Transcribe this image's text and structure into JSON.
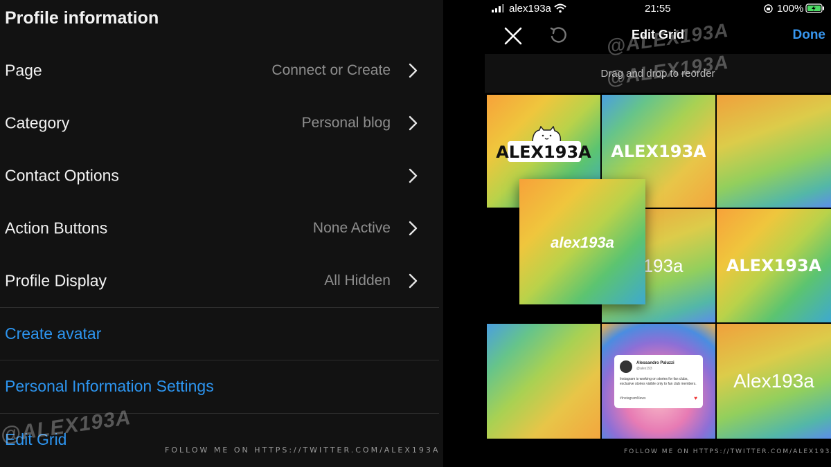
{
  "left": {
    "title": "Profile information",
    "rows": [
      {
        "label": "Page",
        "value": "Connect or Create"
      },
      {
        "label": "Category",
        "value": "Personal blog"
      },
      {
        "label": "Contact Options",
        "value": ""
      },
      {
        "label": "Action Buttons",
        "value": "None Active"
      },
      {
        "label": "Profile Display",
        "value": "All Hidden"
      }
    ],
    "links": [
      "Create avatar",
      "Personal Information Settings",
      "Edit Grid"
    ],
    "watermark": "@ALEX193A",
    "footer": "FOLLOW ME ON HTTPS://TWITTER.COM/ALEX193A"
  },
  "right": {
    "status": {
      "carrier": "alex193a",
      "time": "21:55",
      "battery": "100%"
    },
    "nav": {
      "title": "Edit Grid",
      "done": "Done"
    },
    "subheader": "Drag and drop to reorder",
    "watermark": "@ALEX193A",
    "footer": "FOLLOW ME ON HTTPS://TWITTER.COM/ALEX193A",
    "tiles": {
      "t1": "ALEX193A",
      "t2": "ALEX193A",
      "t5": "x193a",
      "t6": "ALEX193A",
      "t9": "Alex193a",
      "dragged": "alex193a"
    },
    "post_card": {
      "name": "Alessandro Paluzzi",
      "handle": "@alex193",
      "body": "Instagram is working on stories for fan clubs, exclusive stories visible only to fan club members.",
      "tag": "#InstagramNews"
    }
  },
  "colors": {
    "link": "#2d95f0",
    "done": "#3897f0",
    "background": "#121212"
  }
}
